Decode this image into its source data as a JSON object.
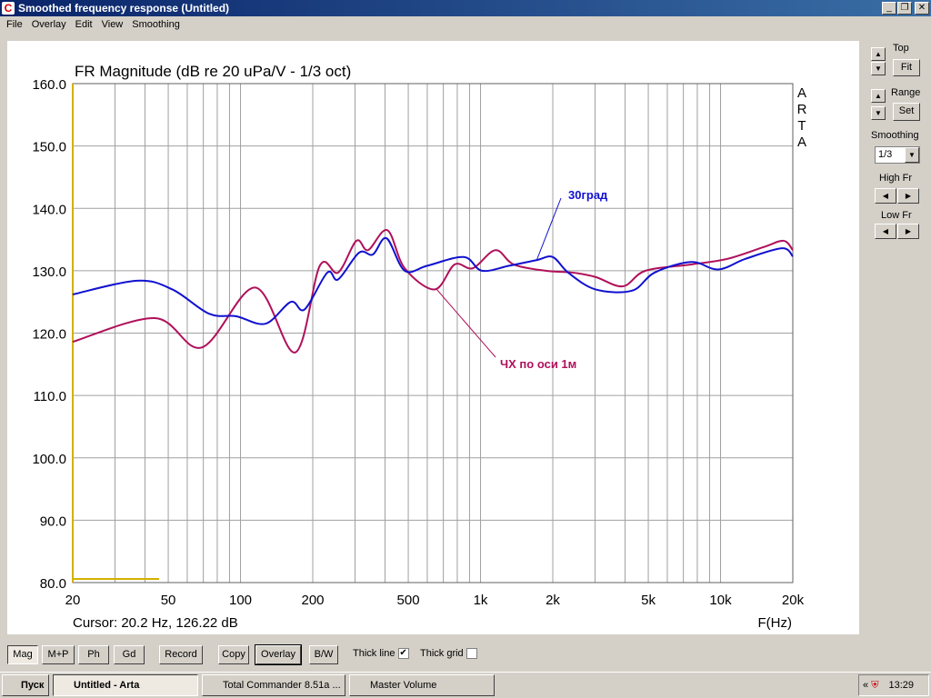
{
  "window": {
    "title": "Smoothed frequency response (Untitled)",
    "min": "_",
    "restore": "❐",
    "close": "✕"
  },
  "menu": [
    "File",
    "Overlay",
    "Edit",
    "View",
    "Smoothing"
  ],
  "side": {
    "top": "Top",
    "fit": "Fit",
    "range": "Range",
    "set": "Set",
    "smoothing": "Smoothing",
    "smoothing_value": "1/3",
    "high_fr": "High Fr",
    "low_fr": "Low Fr"
  },
  "toolbar": {
    "mag": "Mag",
    "mp": "M+P",
    "ph": "Ph",
    "gd": "Gd",
    "record": "Record",
    "copy": "Copy",
    "overlay": "Overlay",
    "bw": "B/W",
    "thick_line": "Thick line",
    "thick_line_checked": true,
    "thick_grid": "Thick grid",
    "thick_grid_checked": false
  },
  "taskbar": {
    "start": "Пуск",
    "tasks": [
      "Untitled - Arta",
      "Total Commander 8.51a ...",
      "Master Volume"
    ],
    "clock": "13:29",
    "tray_arrows": "«"
  },
  "chart_data": {
    "type": "line",
    "title": "FR Magnitude (dB re 20 uPa/V - 1/3 oct)",
    "brand": "ARTA",
    "xlabel": "F(Hz)",
    "xscale": "log",
    "xlim": [
      20,
      20000
    ],
    "ylim": [
      80,
      160
    ],
    "yticks": [
      "80.0",
      "90.0",
      "100.0",
      "110.0",
      "120.0",
      "130.0",
      "140.0",
      "150.0",
      "160.0"
    ],
    "xticks": [
      {
        "v": 20,
        "l": "20"
      },
      {
        "v": 50,
        "l": "50"
      },
      {
        "v": 100,
        "l": "100"
      },
      {
        "v": 200,
        "l": "200"
      },
      {
        "v": 500,
        "l": "500"
      },
      {
        "v": 1000,
        "l": "1k"
      },
      {
        "v": 2000,
        "l": "2k"
      },
      {
        "v": 5000,
        "l": "5k"
      },
      {
        "v": 10000,
        "l": "10k"
      },
      {
        "v": 20000,
        "l": "20k"
      }
    ],
    "cursor": "Cursor: 20.2 Hz, 126.22 dB",
    "series": [
      {
        "name": "ЧХ по оси 1м",
        "color": "#b0105a",
        "x": [
          20,
          44,
          69,
          115,
          169,
          214,
          255,
          304,
          340,
          409,
          483,
          644,
          780,
          929,
          1154,
          1375,
          1867,
          2421,
          3013,
          3917,
          4868,
          7535,
          10670,
          15130,
          18330,
          20000
        ],
        "y": [
          118.6,
          122.4,
          117.7,
          127.3,
          116.9,
          130.8,
          129.7,
          134.8,
          133.3,
          136.5,
          130.4,
          127,
          131,
          130.4,
          133.3,
          131,
          130,
          129.7,
          129,
          127.5,
          130,
          131,
          131.9,
          133.8,
          134.8,
          133.3
        ]
      },
      {
        "name": "30град",
        "color": "#1010d0",
        "x": [
          20,
          37,
          52,
          74,
          96,
          127,
          162,
          185,
          230,
          255,
          312,
          356,
          406,
          483,
          600,
          851,
          1013,
          1316,
          1710,
          2000,
          2318,
          3013,
          4276,
          5310,
          7535,
          9775,
          12700,
          18030,
          20000
        ],
        "y": [
          126.2,
          128.4,
          127,
          123.1,
          122.7,
          121.5,
          125,
          123.8,
          129.7,
          128.6,
          132.9,
          132.6,
          135.2,
          130,
          130.8,
          132.2,
          130,
          130.8,
          131.7,
          132.2,
          129.7,
          127,
          126.8,
          129.7,
          131.4,
          130.2,
          131.9,
          133.6,
          132.3
        ]
      }
    ]
  }
}
